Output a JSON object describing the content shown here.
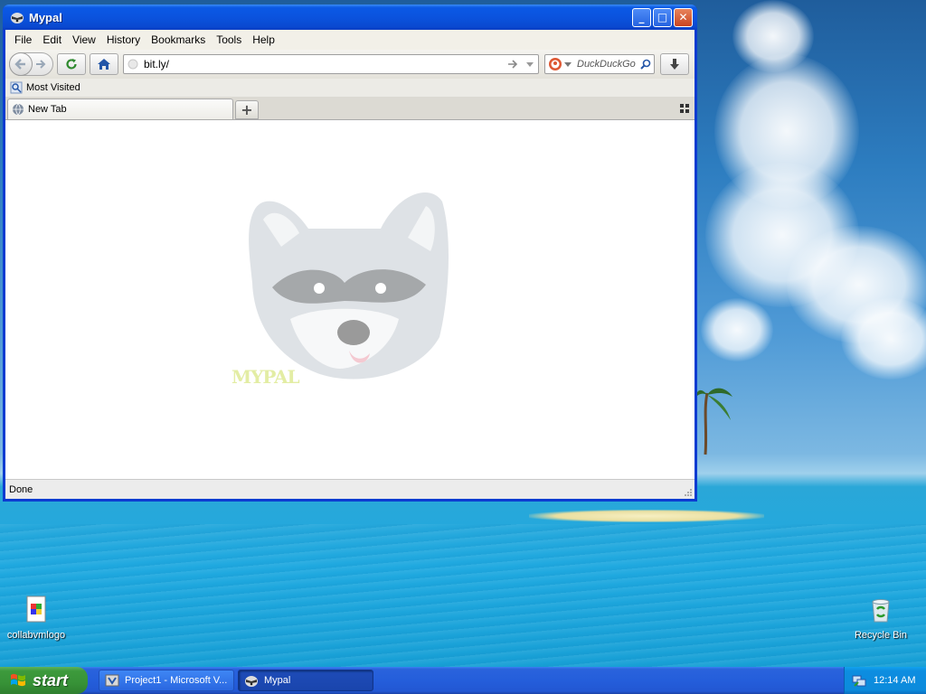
{
  "window": {
    "title": "Mypal",
    "minimize_glyph": "_",
    "maximize_glyph": "□",
    "close_glyph": "✕"
  },
  "menubar": {
    "items": [
      "File",
      "Edit",
      "View",
      "History",
      "Bookmarks",
      "Tools",
      "Help"
    ]
  },
  "navbar": {
    "url_value": "bit.ly/",
    "search_placeholder": "DuckDuckGo"
  },
  "bookmarks": {
    "most_visited": "Most Visited"
  },
  "tabs": {
    "items": [
      {
        "label": "New Tab"
      }
    ],
    "new_tab_glyph": "+"
  },
  "content": {
    "watermark_text": "MYPAL"
  },
  "statusbar": {
    "text": "Done"
  },
  "desktop": {
    "icons": [
      {
        "label": "collabvmlogo"
      },
      {
        "label": "Recycle Bin"
      }
    ]
  },
  "taskbar": {
    "start_label": "start",
    "tasks": [
      {
        "label": "Project1 - Microsoft V..."
      },
      {
        "label": "Mypal"
      }
    ],
    "clock": "12:14 AM"
  },
  "colors": {
    "titlebar": "#0b53de",
    "taskbar": "#245edb",
    "start_green": "#379237",
    "tray": "#0c8bdc"
  }
}
